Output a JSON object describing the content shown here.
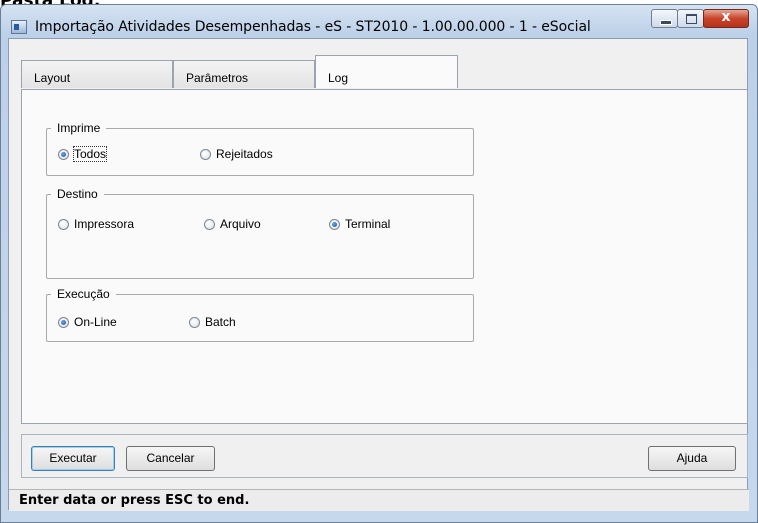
{
  "page_caption": "Pasta Log:",
  "window": {
    "title": "Importação Atividades Desempenhadas - eS - ST2010 - 1.00.00.000 - 1 - eSocial",
    "icon": "app-icon",
    "controls": {
      "minimize": "minimize-icon",
      "maximize": "maximize-icon",
      "close": "x"
    }
  },
  "tabs": [
    {
      "label": "Layout",
      "active": false
    },
    {
      "label": "Parâmetros",
      "active": false
    },
    {
      "label": "Log",
      "active": true
    }
  ],
  "groups": {
    "imprime": {
      "legend": "Imprime",
      "options": [
        {
          "label": "Todos",
          "selected": true
        },
        {
          "label": "Rejeitados",
          "selected": false
        }
      ]
    },
    "destino": {
      "legend": "Destino",
      "options": [
        {
          "label": "Impressora",
          "selected": false
        },
        {
          "label": "Arquivo",
          "selected": false
        },
        {
          "label": "Terminal",
          "selected": true
        }
      ]
    },
    "execucao": {
      "legend": "Execução",
      "options": [
        {
          "label": "On-Line",
          "selected": true
        },
        {
          "label": "Batch",
          "selected": false
        }
      ]
    }
  },
  "buttons": {
    "executar": "Executar",
    "cancelar": "Cancelar",
    "ajuda": "Ajuda"
  },
  "status": "Enter data or press ESC to end."
}
